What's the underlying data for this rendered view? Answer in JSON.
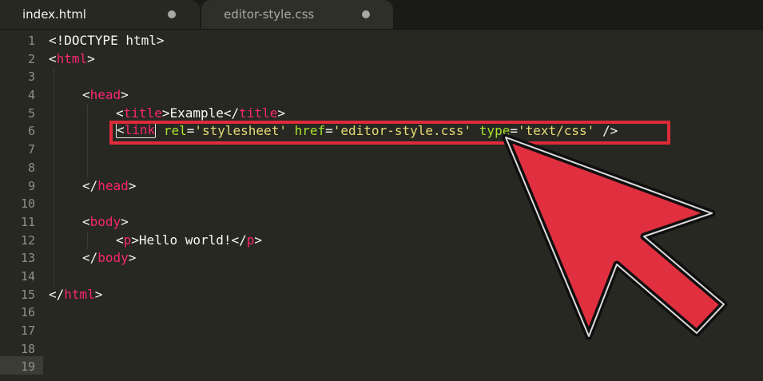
{
  "tabs": [
    {
      "label": "index.html",
      "active": true
    },
    {
      "label": "editor-style.css",
      "active": false
    }
  ],
  "line_numbers": [
    "1",
    "2",
    "3",
    "4",
    "5",
    "6",
    "7",
    "8",
    "9",
    "10",
    "11",
    "12",
    "13",
    "14",
    "15",
    "16",
    "17",
    "18",
    "19"
  ],
  "code": {
    "doctype": "<!DOCTYPE html>",
    "html_open_lt": "<",
    "html_name": "html",
    "gt": ">",
    "head_open_lt": "<",
    "head_name": "head",
    "title_lt": "<",
    "title_name": "title",
    "title_text": "Example",
    "title_close_lt": "</",
    "link_lt": "<",
    "link_name": "link",
    "rel_attr": "rel",
    "rel_value": "'stylesheet'",
    "href_attr": "href",
    "href_value": "'editor-style.css'",
    "type_attr": "type",
    "type_value": "'text/css'",
    "self_close": "/>",
    "eq": "=",
    "head_close_lt": "</",
    "body_open_lt": "<",
    "body_name": "body",
    "p_lt": "<",
    "p_name": "p",
    "p_text": "Hello world!",
    "p_close_lt": "</",
    "body_close_lt": "</",
    "html_close_lt": "</"
  },
  "colors": {
    "background": "#272822",
    "tag": "#f92672",
    "attribute": "#a6e22e",
    "string": "#e6db74",
    "highlight": "#dd2b3a"
  }
}
